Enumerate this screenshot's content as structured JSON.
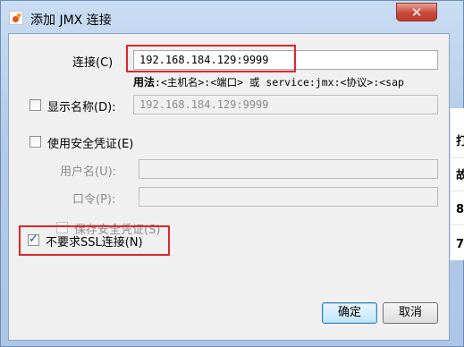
{
  "window": {
    "title": "添加 JMX 连接",
    "close_label": "✕"
  },
  "form": {
    "connection_label": "连接(C)",
    "connection_value": "192.168.184.129:9999",
    "usage_prefix": "用法",
    "usage_text": ":<主机名>:<端口> 或 service:jmx:<协议>:<sap",
    "display_name_label": "显示名称(D):",
    "display_name_value": "192.168.184.129:9999",
    "use_credentials_label": "使用安全凭证(E)",
    "username_label": "用户名(U):",
    "password_label": "口令(P):",
    "save_credentials_label": "保存安全凭证(S)",
    "no_ssl_label": "不要求SSL连接(N)"
  },
  "buttons": {
    "ok": "确定",
    "cancel": "取消"
  },
  "background": {
    "chars": [
      "打",
      "故",
      "8",
      "7"
    ]
  },
  "state": {
    "display_name_checked": false,
    "use_credentials_checked": false,
    "save_credentials_checked": false,
    "no_ssl_checked": true
  },
  "colors": {
    "highlight_box": "#e0252b",
    "title_bar": "#b3cbe9",
    "close_button": "#c0392b"
  }
}
